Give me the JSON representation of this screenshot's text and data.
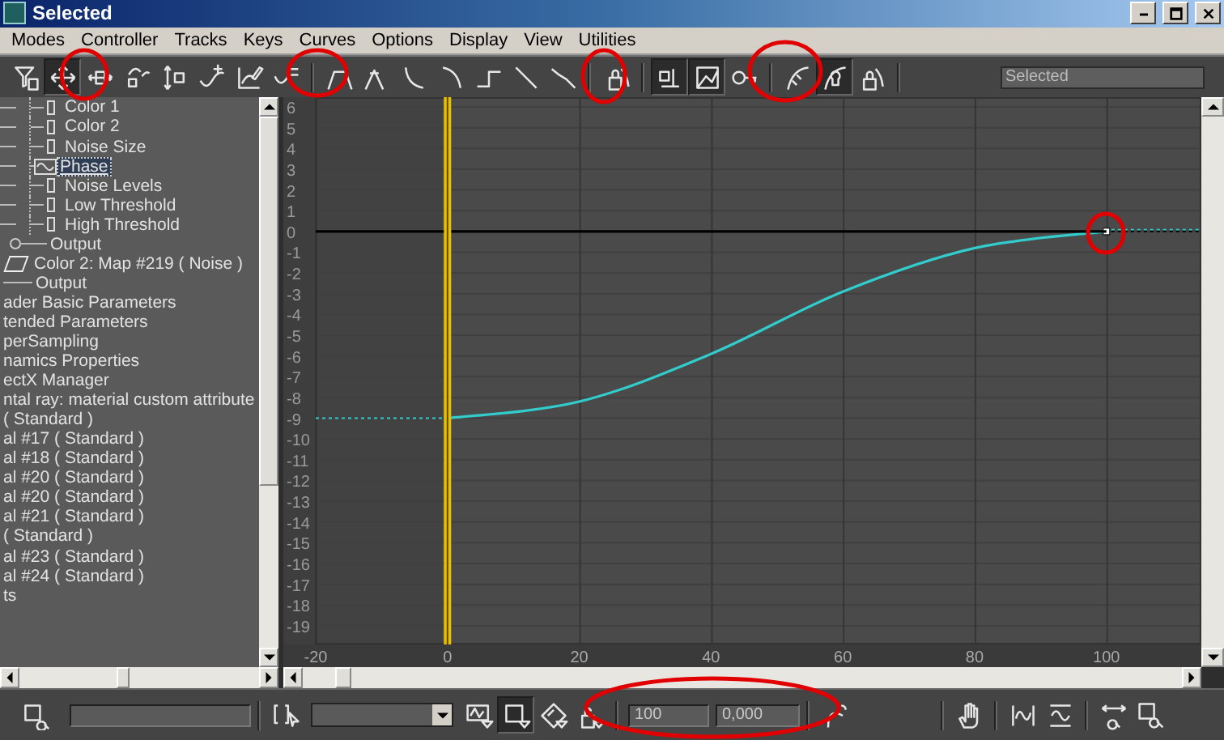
{
  "window": {
    "title": "Selected"
  },
  "menu": [
    "Modes",
    "Controller",
    "Tracks",
    "Keys",
    "Curves",
    "Options",
    "Display",
    "View",
    "Utilities"
  ],
  "toolbar": {
    "buttons": [
      {
        "pressed": false
      },
      {
        "pressed": true
      },
      {
        "pressed": false
      },
      {
        "pressed": false
      },
      {
        "pressed": false
      },
      {
        "pressed": false
      },
      {
        "pressed": false
      },
      {
        "pressed": false
      },
      {
        "pressed": false
      },
      {
        "pressed": false
      },
      {
        "pressed": false
      },
      {
        "pressed": false
      },
      {
        "pressed": false
      },
      {
        "pressed": false
      },
      {
        "pressed": false
      },
      {
        "pressed": false
      },
      {
        "pressed": true
      },
      {
        "pressed": true
      },
      {
        "pressed": false
      },
      {
        "pressed": false
      },
      {
        "pressed": true
      },
      {
        "pressed": false
      }
    ],
    "selection_field": {
      "value": "Selected"
    }
  },
  "tree": {
    "items": [
      {
        "kind": "track",
        "label": "Color 1",
        "selected": false
      },
      {
        "kind": "track",
        "label": "Color 2",
        "selected": false
      },
      {
        "kind": "track",
        "label": "Noise Size",
        "selected": false
      },
      {
        "kind": "curve",
        "label": "Phase",
        "selected": true
      },
      {
        "kind": "track",
        "label": "Noise Levels",
        "selected": false
      },
      {
        "kind": "track",
        "label": "Low Threshold",
        "selected": false
      },
      {
        "kind": "track",
        "label": "High Threshold",
        "selected": false
      },
      {
        "kind": "expandable",
        "label": "Output",
        "selected": false
      },
      {
        "kind": "map",
        "label": "Color 2: Map #219 ( Noise )",
        "selected": false
      },
      {
        "kind": "branch",
        "label": "Output",
        "selected": false
      },
      {
        "kind": "plain",
        "label": "ader Basic Parameters",
        "selected": false
      },
      {
        "kind": "plain",
        "label": "tended Parameters",
        "selected": false
      },
      {
        "kind": "plain",
        "label": "perSampling",
        "selected": false
      },
      {
        "kind": "plain",
        "label": "namics Properties",
        "selected": false
      },
      {
        "kind": "plain",
        "label": "ectX Manager",
        "selected": false
      },
      {
        "kind": "plain",
        "label": "ntal ray: material custom attribute",
        "selected": false
      },
      {
        "kind": "plain",
        "label": "( Standard )",
        "selected": false
      },
      {
        "kind": "plain",
        "label": "al #17 ( Standard )",
        "selected": false
      },
      {
        "kind": "plain",
        "label": "al #18 ( Standard )",
        "selected": false
      },
      {
        "kind": "plain",
        "label": "al #20 ( Standard )",
        "selected": false
      },
      {
        "kind": "plain",
        "label": "al #20 ( Standard )",
        "selected": false
      },
      {
        "kind": "plain",
        "label": "al #21 ( Standard )",
        "selected": false
      },
      {
        "kind": "plain",
        "label": "( Standard )",
        "selected": false
      },
      {
        "kind": "plain",
        "label": "al #23 ( Standard )",
        "selected": false
      },
      {
        "kind": "plain",
        "label": "al #24 ( Standard )",
        "selected": false
      },
      {
        "kind": "plain",
        "label": "ts",
        "selected": false
      }
    ]
  },
  "curve_editor": {
    "chart_data": {
      "type": "line",
      "x": [
        -20,
        0,
        20,
        40,
        60,
        80,
        100,
        114.4
      ],
      "series": [
        {
          "color": "#33cccc",
          "values": [
            -9,
            -9,
            -8.2,
            -5.9,
            -2.9,
            -0.8,
            0,
            0
          ]
        },
        {
          "color": "#000000",
          "values": [
            0,
            0,
            0,
            0,
            0,
            0,
            0,
            0
          ]
        }
      ],
      "xlim": [
        -20,
        114.4
      ],
      "ylim": [
        -19.9,
        6.47
      ],
      "grid": true,
      "ref_lines": [
        {
          "axis": "x",
          "value": 0,
          "color": "#e8c000"
        }
      ],
      "xticks": [
        -20,
        0,
        20,
        40,
        60,
        80,
        100
      ],
      "yticks": [
        6,
        5,
        4,
        3,
        2,
        1,
        0,
        -1,
        -2,
        -3,
        -4,
        -5,
        -6,
        -7,
        -8,
        -9,
        -10,
        -11,
        -12,
        -13,
        -14,
        -15,
        -16,
        -17,
        -18,
        -19
      ]
    }
  },
  "bottom_bar": {
    "buttons": [
      {
        "pressed": false
      },
      {
        "pressed": false
      },
      {
        "pressed": false
      },
      {
        "pressed": true
      },
      {
        "pressed": false
      },
      {
        "pressed": false
      },
      {
        "pressed": false
      },
      {
        "pressed": false
      },
      {
        "pressed": false
      },
      {
        "pressed": false
      },
      {
        "pressed": false
      },
      {
        "pressed": false
      }
    ],
    "frame_field": {
      "value": "100"
    },
    "value_field": {
      "value": "0,000"
    }
  }
}
